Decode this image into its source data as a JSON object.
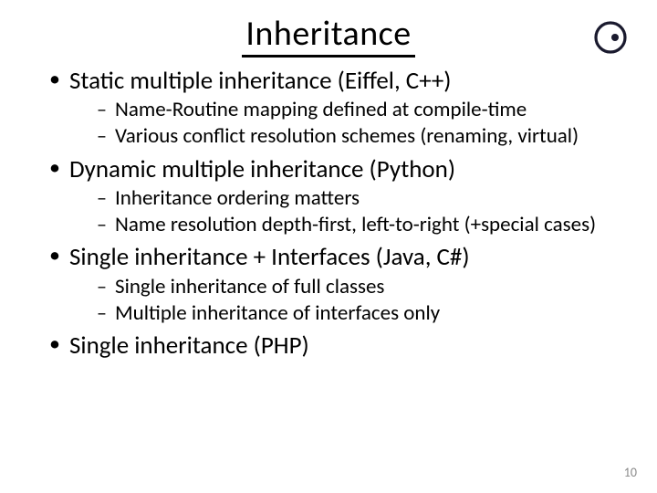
{
  "title": "Inheritance",
  "bullets": [
    {
      "text": "Static multiple inheritance (Eiffel, C++)",
      "sub": [
        "Name-Routine mapping defined at compile-time",
        "Various conflict resolution schemes (renaming, virtual)"
      ]
    },
    {
      "text": "Dynamic multiple inheritance (Python)",
      "sub": [
        "Inheritance ordering matters",
        "Name resolution depth-first, left-to-right (+special cases)"
      ]
    },
    {
      "text": "Single inheritance + Interfaces (Java, C#)",
      "sub": [
        "Single inheritance of full classes",
        "Multiple inheritance of interfaces only"
      ]
    },
    {
      "text": "Single inheritance (PHP)",
      "sub": []
    }
  ],
  "page_number": "10",
  "logo_name": "eiffel-logo"
}
